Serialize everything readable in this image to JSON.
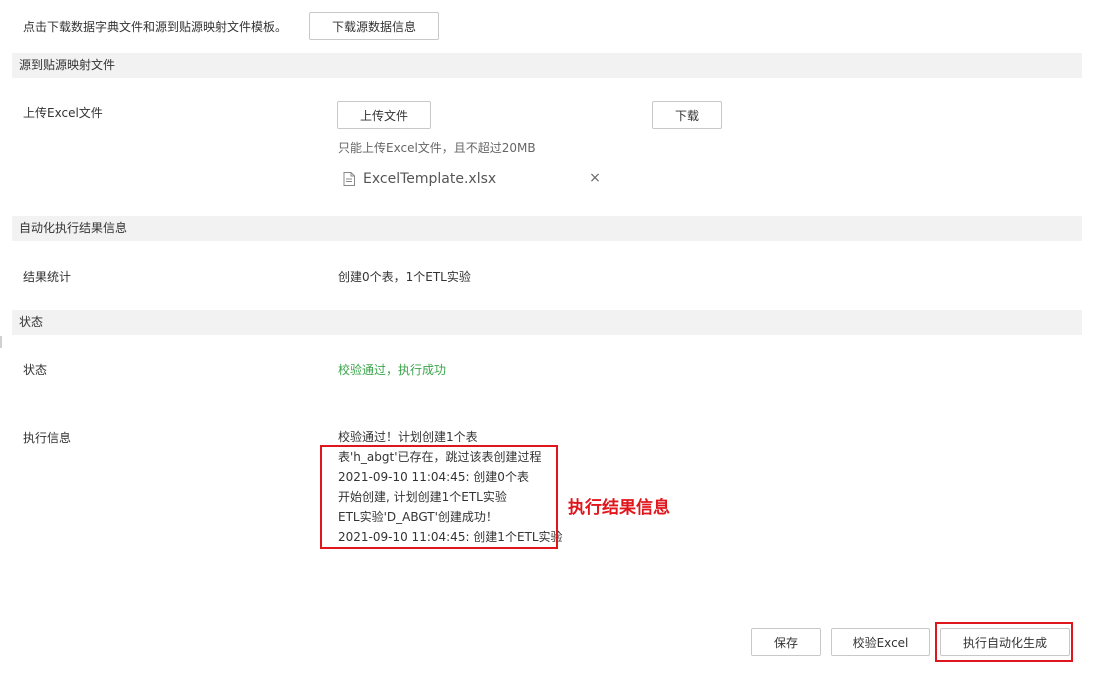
{
  "top": {
    "hint": "点击下载数据字典文件和源到贴源映射文件模板。",
    "download_source_button": "下载源数据信息"
  },
  "mapping_section": {
    "title": "源到贴源映射文件",
    "upload_label": "上传Excel文件",
    "upload_button": "上传文件",
    "download_button": "下载",
    "upload_tip": "只能上传Excel文件，且不超过20MB",
    "file": {
      "name": "ExcelTemplate.xlsx",
      "icon": "document-icon",
      "remove_glyph": "×"
    }
  },
  "result_section": {
    "title": "自动化执行结果信息",
    "stats_label": "结果统计",
    "stats_value": "创建0个表，1个ETL实验"
  },
  "status_section": {
    "title": "状态",
    "status_label": "状态",
    "status_value": "校验通过，执行成功",
    "status_color": "#3aa54a",
    "exec_label": "执行信息",
    "exec_lines": [
      "校验通过！计划创建1个表",
      "表'h_abgt'已存在，跳过该表创建过程",
      "2021-09-10 11:04:45: 创建0个表",
      "开始创建, 计划创建1个ETL实验",
      "ETL实验'D_ABGT'创建成功！",
      "2021-09-10 11:04:45: 创建1个ETL实验"
    ]
  },
  "annotation": {
    "text": "执行结果信息",
    "color": "#e0161d"
  },
  "footer": {
    "save_button": "保存",
    "validate_button": "校验Excel",
    "execute_button": "执行自动化生成"
  }
}
